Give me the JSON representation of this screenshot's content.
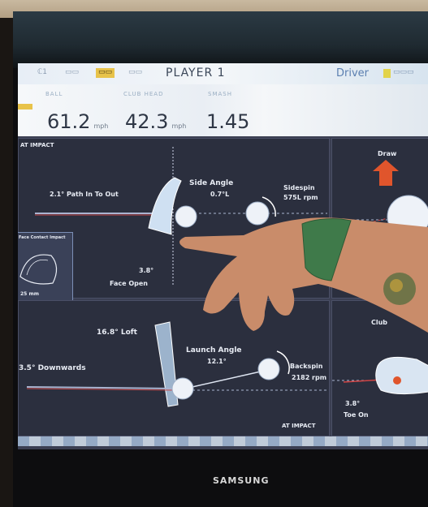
{
  "screen": {
    "tabs": [
      "ℂ1",
      "▭▭",
      "▭▭",
      "▭▭"
    ],
    "player_title": "PLAYER 1",
    "club_name": "Driver",
    "club_tab": "▭▭▭",
    "stats": [
      {
        "label": "BALL",
        "value": "61.2",
        "unit": "mph"
      },
      {
        "label": "CLUB HEAD",
        "value": "42.3",
        "unit": "mph"
      },
      {
        "label": "SMASH",
        "value": "1.45",
        "unit": ""
      }
    ],
    "panel_top_left": {
      "title": "AT IMPACT",
      "path": "2.1° Path In To Out",
      "side_angle_title": "Side Angle",
      "side_angle_value": "0.7°L",
      "sidespin_title": "Sidespin",
      "sidespin_value": "575L rpm",
      "face_value": "3.8°",
      "face_label": "Face Open",
      "inset_title": "Face Contact Impact",
      "inset_value": "25 mm"
    },
    "panel_top_right": {
      "title": "Draw"
    },
    "panel_bottom_left": {
      "loft": "16.8° Loft",
      "attack": "3.5° Downwards",
      "launch_title": "Launch Angle",
      "launch_value": "12.1°",
      "backspin_title": "Backspin",
      "backspin_value": "2182 rpm",
      "footer": "AT IMPACT"
    },
    "panel_bottom_right": {
      "title": "Club",
      "toe_value": "3.8°",
      "toe_label": "Toe On"
    }
  },
  "bezel": {
    "brand": "SAMSUNG"
  },
  "colors": {
    "accent_yellow": "#e8c34a",
    "panel_bg": "#2b2f3e",
    "arrow_red": "#e0552c"
  }
}
